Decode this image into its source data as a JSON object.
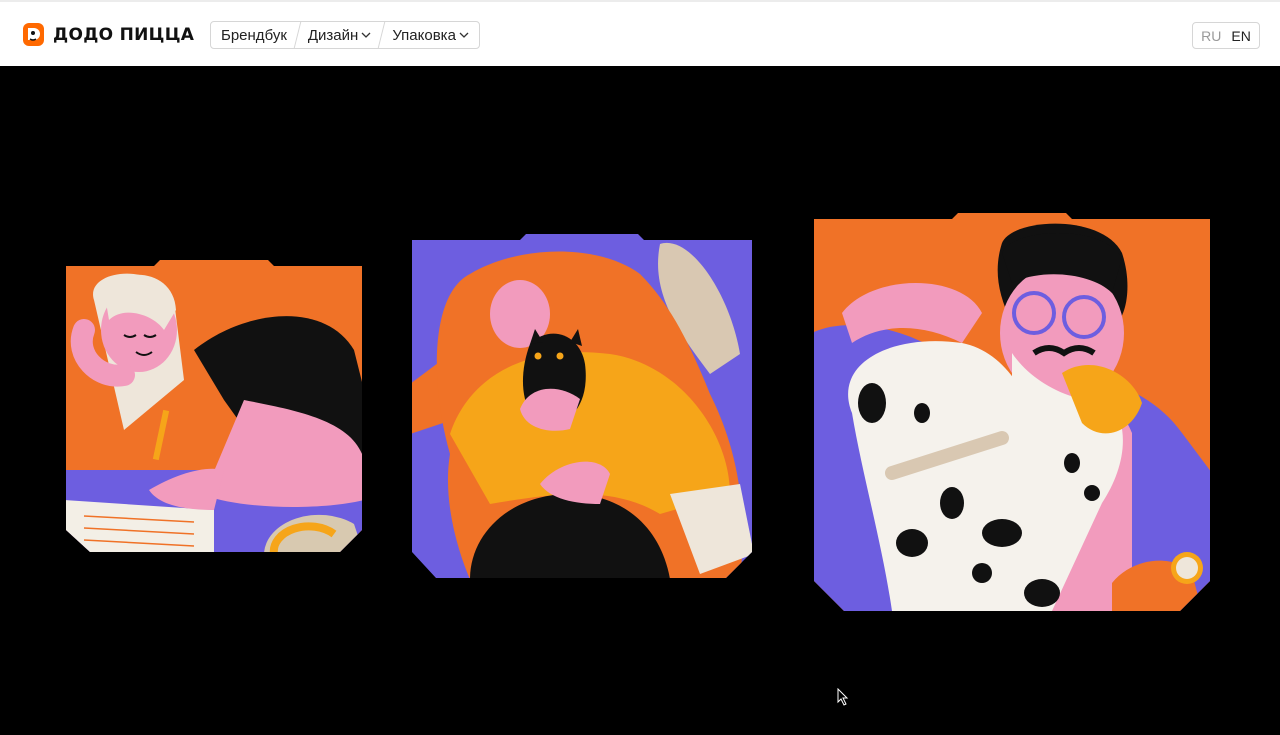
{
  "header": {
    "brand_name": "ДОДО ПИЦЦА",
    "nav": [
      {
        "label": "Брендбук",
        "has_dropdown": false
      },
      {
        "label": "Дизайн",
        "has_dropdown": true
      },
      {
        "label": "Упаковка",
        "has_dropdown": true
      }
    ],
    "lang": {
      "ru": "RU",
      "en": "EN",
      "active": "EN"
    }
  },
  "colors": {
    "orange": "#f07227",
    "purple": "#6d5ee0",
    "pink": "#f29bbd",
    "yellow": "#f6a519",
    "black": "#000000",
    "cream": "#eee6da"
  },
  "showcase": {
    "boxes": [
      {
        "icon": "girl-writing-illustration"
      },
      {
        "icon": "woman-with-cat-illustration"
      },
      {
        "icon": "man-with-dalmatian-illustration"
      }
    ]
  }
}
